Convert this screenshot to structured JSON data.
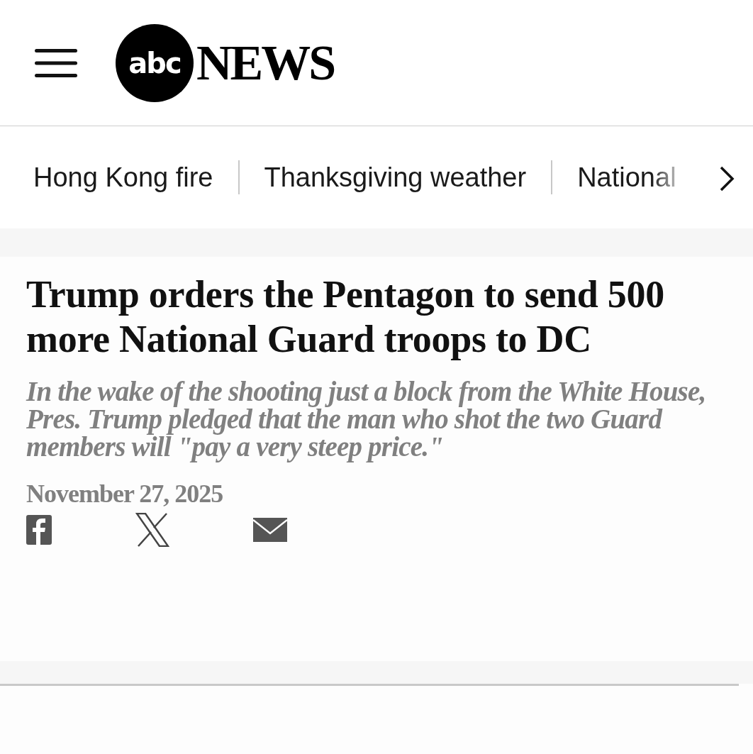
{
  "header": {
    "logo": {
      "mark": "abc",
      "word": "NEWS"
    }
  },
  "trending": {
    "items": [
      {
        "label": "Hong Kong fire"
      },
      {
        "label": "Thanksgiving weather"
      },
      {
        "label": "National"
      }
    ]
  },
  "article": {
    "headline": "Trump orders the Pentagon to send 500 more National Guard troops to DC",
    "summary": "In the wake of the shooting just a block from the White House, Pres. Trump pledged that the man who shot the two Guard members will \"pay a very steep price.\"",
    "date": "November 27, 2025",
    "share": [
      {
        "kind": "facebook"
      },
      {
        "kind": "x"
      },
      {
        "kind": "email"
      }
    ]
  }
}
